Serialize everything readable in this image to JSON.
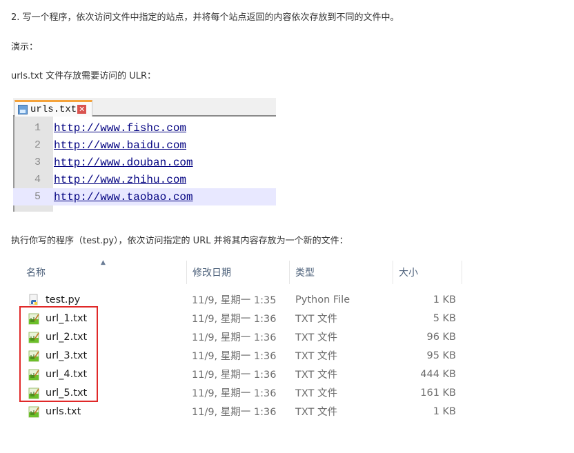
{
  "document": {
    "task_text": "2. 写一个程序，依次访问文件中指定的站点，并将每个站点返回的内容依次存放到不同的文件中。",
    "demo_label": "演示：",
    "urls_intro": "urls.txt 文件存放需要访问的 ULR：",
    "run_intro": "执行你写的程序（test.py），依次访问指定的 URL 并将其内容存放为一个新的文件："
  },
  "editor": {
    "tab_label": "urls.txt",
    "tab_close_glyph": "✕",
    "icons": {
      "tab": "save-disk-icon",
      "close": "close-icon"
    },
    "colors": {
      "tab_accent": "#f4a23a",
      "link": "#000080",
      "current_line": "#e8e8ff"
    },
    "lines": [
      {
        "num": "1",
        "text": "http://www.fishc.com"
      },
      {
        "num": "2",
        "text": "http://www.baidu.com"
      },
      {
        "num": "3",
        "text": "http://www.douban.com"
      },
      {
        "num": "4",
        "text": "http://www.zhihu.com"
      },
      {
        "num": "5",
        "text": "http://www.taobao.com"
      }
    ],
    "current_line": 5
  },
  "explorer": {
    "columns": {
      "name": "名称",
      "date": "修改日期",
      "type": "类型",
      "size": "大小"
    },
    "sort_indicator": "▲",
    "files": [
      {
        "name": "test.py",
        "date": "11/9, 星期一 1:35",
        "type": "Python File",
        "size": "1 KB",
        "icon": "python-file-icon"
      },
      {
        "name": "url_1.txt",
        "date": "11/9, 星期一 1:36",
        "type": "TXT 文件",
        "size": "5 KB",
        "icon": "text-file-icon"
      },
      {
        "name": "url_2.txt",
        "date": "11/9, 星期一 1:36",
        "type": "TXT 文件",
        "size": "96 KB",
        "icon": "text-file-icon"
      },
      {
        "name": "url_3.txt",
        "date": "11/9, 星期一 1:36",
        "type": "TXT 文件",
        "size": "95 KB",
        "icon": "text-file-icon"
      },
      {
        "name": "url_4.txt",
        "date": "11/9, 星期一 1:36",
        "type": "TXT 文件",
        "size": "444 KB",
        "icon": "text-file-icon"
      },
      {
        "name": "url_5.txt",
        "date": "11/9, 星期一 1:36",
        "type": "TXT 文件",
        "size": "161 KB",
        "icon": "text-file-icon"
      },
      {
        "name": "urls.txt",
        "date": "11/9, 星期一 1:36",
        "type": "TXT 文件",
        "size": "1 KB",
        "icon": "text-file-icon"
      }
    ],
    "highlight_color": "#e02828"
  }
}
